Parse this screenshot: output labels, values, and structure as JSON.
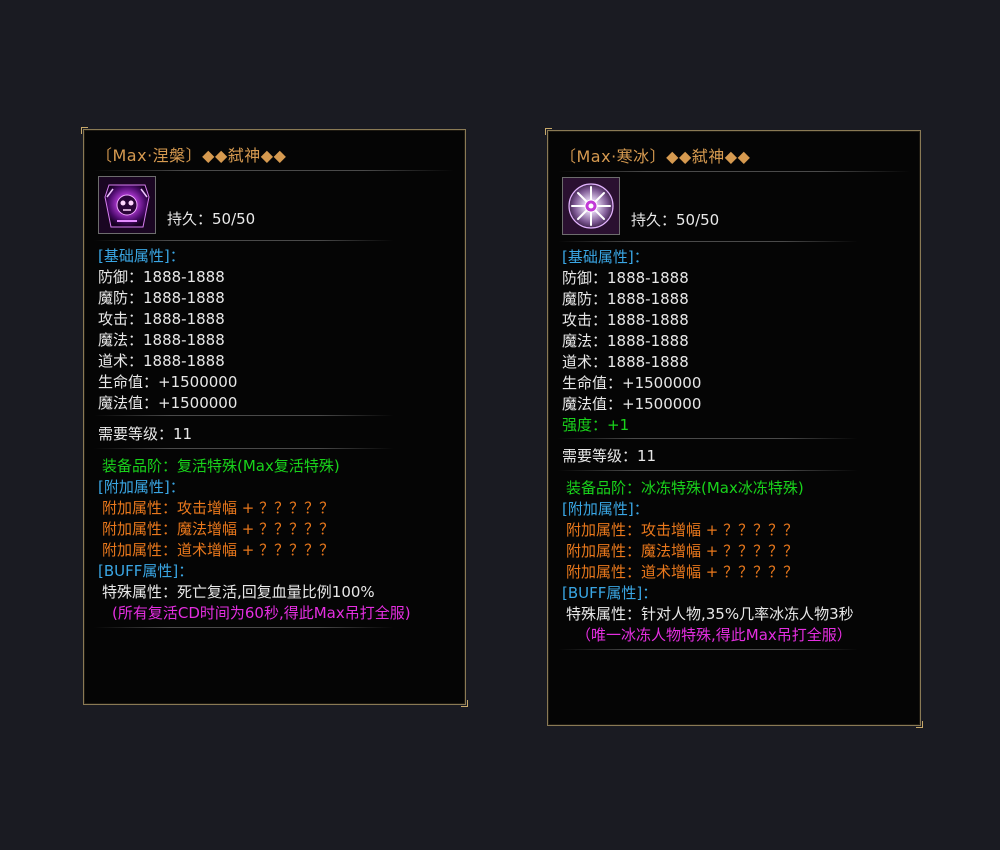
{
  "panels": [
    {
      "title": "〔Max·涅槃〕◆◆弑神◆◆",
      "icon": "purple-skull-medal-icon",
      "durability": "持久：50/50",
      "base_header": "[基础属性]：",
      "base_stats": [
        "防御：1888-1888",
        "魔防：1888-1888",
        "攻击：1888-1888",
        "魔法：1888-1888",
        "道术：1888-1888",
        "生命值：+1500000",
        "魔法值：+1500000"
      ],
      "level": "需要等级：11",
      "grade": "装备品阶：复活特殊(Max复活特殊)",
      "extra_header": "[附加属性]：",
      "extra": [
        "附加属性：攻击增幅 + ？？？？？",
        "附加属性：魔法增幅 + ？？？？？",
        "附加属性：道术增幅 + ？？？？？"
      ],
      "buff_header": "[BUFF属性]：",
      "special": "特殊属性：死亡复活,回复血量比例100%",
      "note": "(所有复活CD时间为60秒,得此Max吊打全服)"
    },
    {
      "title": "〔Max·寒冰〕◆◆弑神◆◆",
      "icon": "ice-snowflake-medal-icon",
      "durability": "持久：50/50",
      "base_header": "[基础属性]：",
      "base_stats": [
        "防御：1888-1888",
        "魔防：1888-1888",
        "攻击：1888-1888",
        "魔法：1888-1888",
        "道术：1888-1888",
        "生命值：+1500000",
        "魔法值：+1500000"
      ],
      "strength": "强度：+1",
      "level": "需要等级：11",
      "grade": "装备品阶：冰冻特殊(Max冰冻特殊)",
      "extra_header": "[附加属性]：",
      "extra": [
        "附加属性：攻击增幅 + ？？？？？",
        "附加属性：魔法增幅 + ？？？？？",
        "附加属性：道术增幅 + ？？？？？"
      ],
      "buff_header": "[BUFF属性]：",
      "special": "特殊属性：针对人物,35%几率冰冻人物3秒",
      "note": "（唯一冰冻人物特殊,得此Max吊打全服）"
    }
  ],
  "colors": {
    "title": "#d69a50",
    "header": "#3aa6e4",
    "stat": "#e8e8e8",
    "grade": "#19d31b",
    "extra": "#e9781c",
    "note": "#e42ee0",
    "border": "#8a7a55"
  }
}
